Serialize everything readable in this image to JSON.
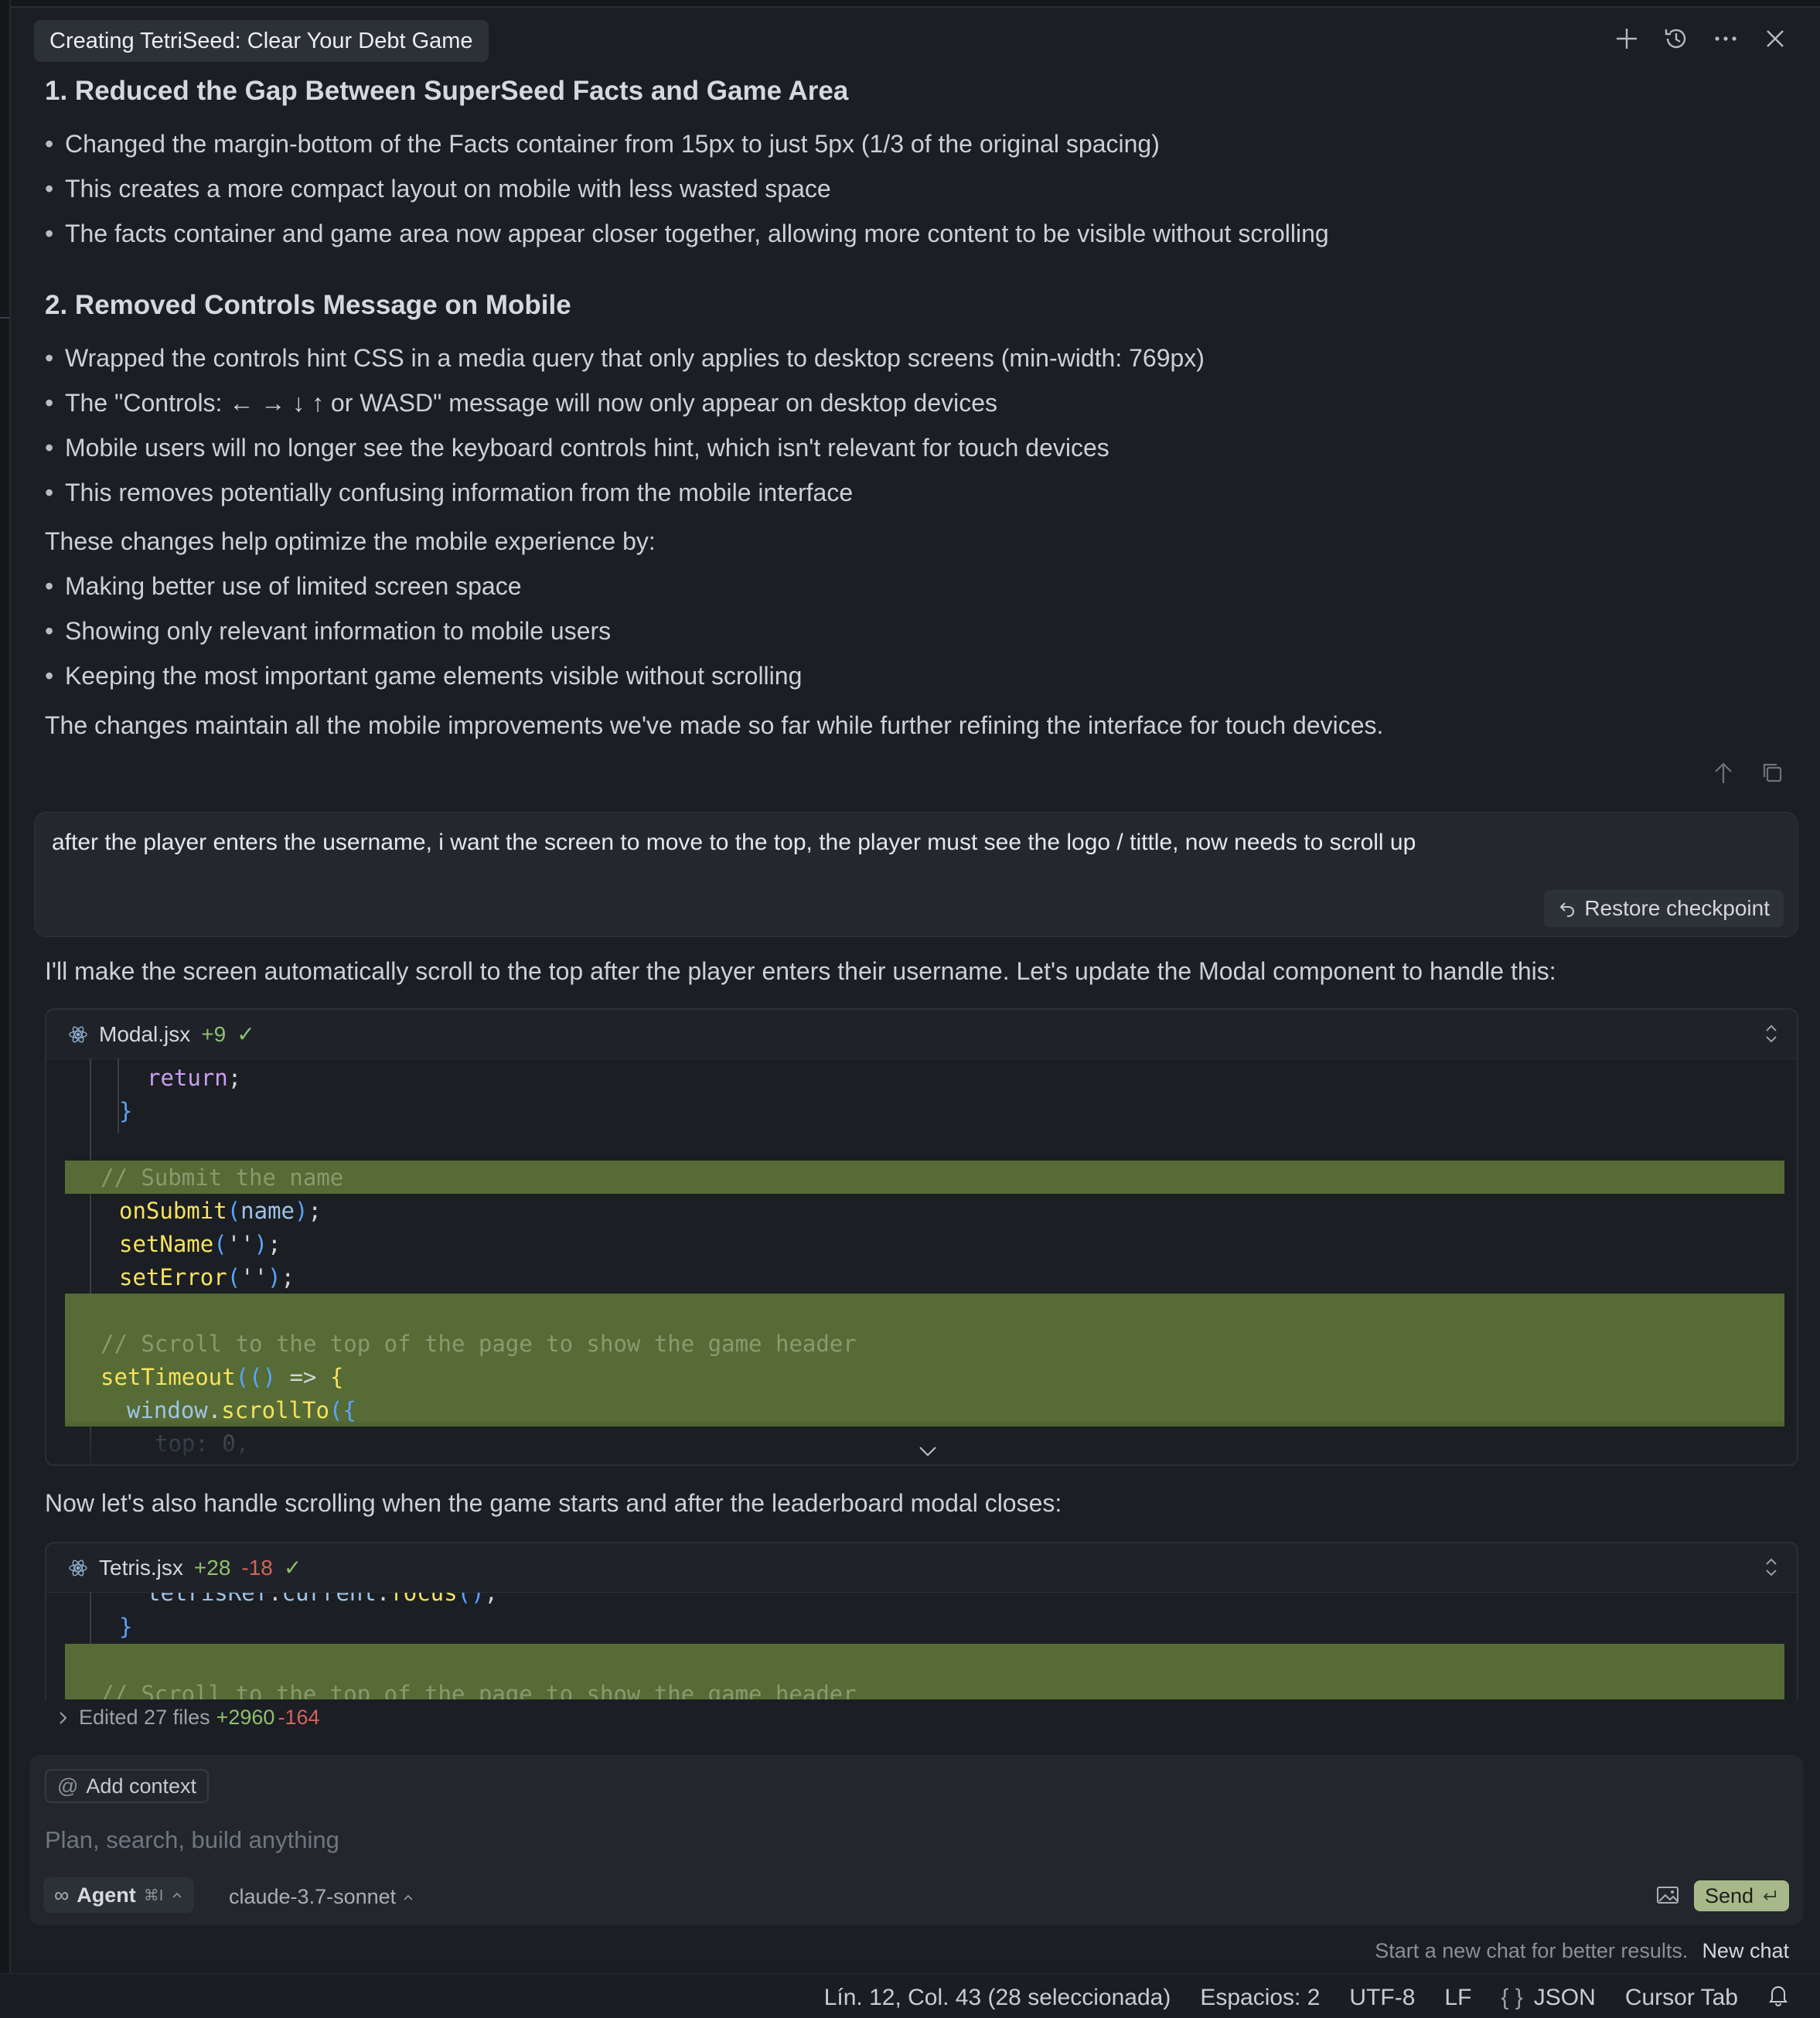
{
  "header": {
    "title": "Creating TetriSeed: Clear Your Debt Game",
    "icons": [
      "plus-icon",
      "history-icon",
      "more-icon",
      "close-icon"
    ]
  },
  "assistant_message_1": {
    "sections": [
      {
        "heading": "1. Reduced the Gap Between SuperSeed Facts and Game Area",
        "bullets": [
          "Changed the margin-bottom of the Facts container from 15px to just 5px (1/3 of the original spacing)",
          "This creates a more compact layout on mobile with less wasted space",
          "The facts container and game area now appear closer together, allowing more content to be visible without scrolling"
        ]
      },
      {
        "heading": "2. Removed Controls Message on Mobile",
        "bullets": [
          "Wrapped the controls hint CSS in a media query that only applies to desktop screens (min-width: 769px)",
          "The \"Controls: ← → ↓ ↑ or WASD\" message will now only appear on desktop devices",
          "Mobile users will no longer see the keyboard controls hint, which isn't relevant for touch devices",
          "This removes potentially confusing information from the mobile interface"
        ]
      }
    ],
    "summary_intro": "These changes help optimize the mobile experience by:",
    "summary_bullets": [
      "Making better use of limited screen space",
      "Showing only relevant information to mobile users",
      "Keeping the most important game elements visible without scrolling"
    ],
    "closing": "The changes maintain all the mobile improvements we've made so far while further refining the interface for touch devices."
  },
  "user_message": {
    "text": "after the player enters the username, i want the screen to move to the top, the player must see the logo / tittle, now needs to scroll up",
    "restore_label": "Restore checkpoint"
  },
  "assistant_message_2": {
    "intro": "I'll make the screen automatically scroll to the top after the player enters their username. Let's update the Modal component to handle this:",
    "file1": {
      "name": "Modal.jsx",
      "added": "+9",
      "lines": [
        "return;",
        "}",
        "",
        "// Submit the name",
        "onSubmit(name);",
        "setName('');",
        "setError('');",
        "",
        "// Scroll to the top of the page to show the game header",
        "setTimeout(() => {",
        "  window.scrollTo({",
        "    top: 0,"
      ]
    },
    "middle": "Now let's also handle scrolling when the game starts and after the leaderboard modal closes:",
    "file2": {
      "name": "Tetris.jsx",
      "added": "+28",
      "removed": "-18",
      "lines": [
        "tetrisRef.current.focus();",
        "}",
        "",
        "// Scroll to the top of the page to show the game header"
      ]
    }
  },
  "edited_summary": {
    "label": "Edited 27 files",
    "added": "+2960",
    "removed": "-164"
  },
  "composer": {
    "add_context": "Add context",
    "placeholder": "Plan, search, build anything",
    "agent_label": "Agent",
    "agent_shortcut": "⌘I",
    "model": "claude-3.7-sonnet",
    "send_label": "Send"
  },
  "hint": {
    "text": "Start a new chat for better results.",
    "new_chat": "New chat"
  },
  "status_bar": {
    "position": "Lín. 12, Col. 43 (28 seleccionada)",
    "spaces": "Espacios: 2",
    "encoding": "UTF-8",
    "eol": "LF",
    "language": "JSON",
    "cursor_tab": "Cursor Tab"
  },
  "colors": {
    "diff_added_bg": "#566b35",
    "added_text": "#8fc06f",
    "removed_text": "#d3635d",
    "send_bg": "#a7b98a"
  }
}
